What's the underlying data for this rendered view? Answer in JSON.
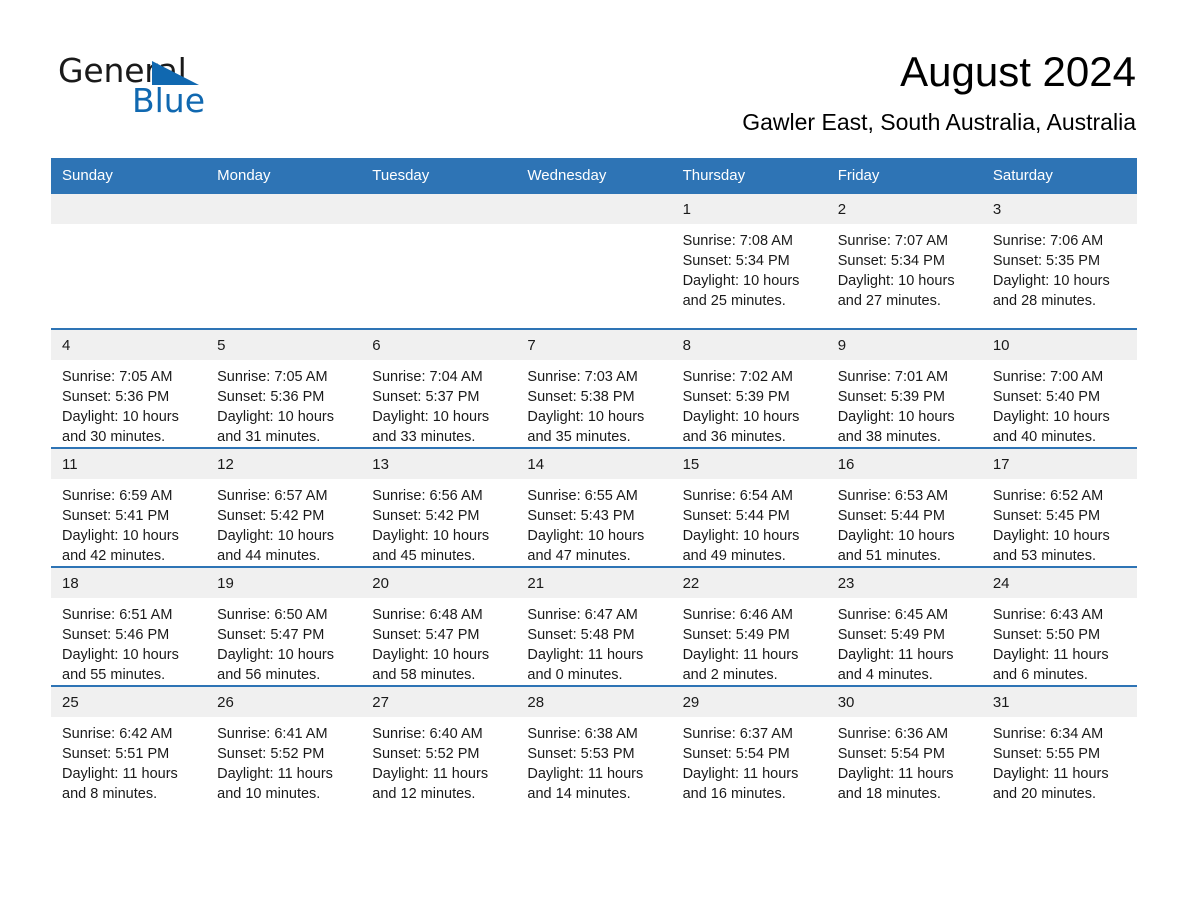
{
  "logo": {
    "word_one": "General",
    "word_two": "Blue",
    "triangle_color": "#1068b0",
    "icon": "triangle-icon"
  },
  "header": {
    "title": "August 2024",
    "location": "Gawler East, South Australia, Australia"
  },
  "theme": {
    "header_blue": "#2e74b5",
    "daynum_band": "#f0f0f0",
    "text": "#1a1a1a"
  },
  "weekdays": [
    "Sunday",
    "Monday",
    "Tuesday",
    "Wednesday",
    "Thursday",
    "Friday",
    "Saturday"
  ],
  "weeks": [
    [
      {
        "day": "",
        "lines": []
      },
      {
        "day": "",
        "lines": []
      },
      {
        "day": "",
        "lines": []
      },
      {
        "day": "",
        "lines": []
      },
      {
        "day": "1",
        "lines": [
          "Sunrise: 7:08 AM",
          "Sunset: 5:34 PM",
          "Daylight: 10 hours",
          "and 25 minutes."
        ]
      },
      {
        "day": "2",
        "lines": [
          "Sunrise: 7:07 AM",
          "Sunset: 5:34 PM",
          "Daylight: 10 hours",
          "and 27 minutes."
        ]
      },
      {
        "day": "3",
        "lines": [
          "Sunrise: 7:06 AM",
          "Sunset: 5:35 PM",
          "Daylight: 10 hours",
          "and 28 minutes."
        ]
      }
    ],
    [
      {
        "day": "4",
        "lines": [
          "Sunrise: 7:05 AM",
          "Sunset: 5:36 PM",
          "Daylight: 10 hours",
          "and 30 minutes."
        ]
      },
      {
        "day": "5",
        "lines": [
          "Sunrise: 7:05 AM",
          "Sunset: 5:36 PM",
          "Daylight: 10 hours",
          "and 31 minutes."
        ]
      },
      {
        "day": "6",
        "lines": [
          "Sunrise: 7:04 AM",
          "Sunset: 5:37 PM",
          "Daylight: 10 hours",
          "and 33 minutes."
        ]
      },
      {
        "day": "7",
        "lines": [
          "Sunrise: 7:03 AM",
          "Sunset: 5:38 PM",
          "Daylight: 10 hours",
          "and 35 minutes."
        ]
      },
      {
        "day": "8",
        "lines": [
          "Sunrise: 7:02 AM",
          "Sunset: 5:39 PM",
          "Daylight: 10 hours",
          "and 36 minutes."
        ]
      },
      {
        "day": "9",
        "lines": [
          "Sunrise: 7:01 AM",
          "Sunset: 5:39 PM",
          "Daylight: 10 hours",
          "and 38 minutes."
        ]
      },
      {
        "day": "10",
        "lines": [
          "Sunrise: 7:00 AM",
          "Sunset: 5:40 PM",
          "Daylight: 10 hours",
          "and 40 minutes."
        ]
      }
    ],
    [
      {
        "day": "11",
        "lines": [
          "Sunrise: 6:59 AM",
          "Sunset: 5:41 PM",
          "Daylight: 10 hours",
          "and 42 minutes."
        ]
      },
      {
        "day": "12",
        "lines": [
          "Sunrise: 6:57 AM",
          "Sunset: 5:42 PM",
          "Daylight: 10 hours",
          "and 44 minutes."
        ]
      },
      {
        "day": "13",
        "lines": [
          "Sunrise: 6:56 AM",
          "Sunset: 5:42 PM",
          "Daylight: 10 hours",
          "and 45 minutes."
        ]
      },
      {
        "day": "14",
        "lines": [
          "Sunrise: 6:55 AM",
          "Sunset: 5:43 PM",
          "Daylight: 10 hours",
          "and 47 minutes."
        ]
      },
      {
        "day": "15",
        "lines": [
          "Sunrise: 6:54 AM",
          "Sunset: 5:44 PM",
          "Daylight: 10 hours",
          "and 49 minutes."
        ]
      },
      {
        "day": "16",
        "lines": [
          "Sunrise: 6:53 AM",
          "Sunset: 5:44 PM",
          "Daylight: 10 hours",
          "and 51 minutes."
        ]
      },
      {
        "day": "17",
        "lines": [
          "Sunrise: 6:52 AM",
          "Sunset: 5:45 PM",
          "Daylight: 10 hours",
          "and 53 minutes."
        ]
      }
    ],
    [
      {
        "day": "18",
        "lines": [
          "Sunrise: 6:51 AM",
          "Sunset: 5:46 PM",
          "Daylight: 10 hours",
          "and 55 minutes."
        ]
      },
      {
        "day": "19",
        "lines": [
          "Sunrise: 6:50 AM",
          "Sunset: 5:47 PM",
          "Daylight: 10 hours",
          "and 56 minutes."
        ]
      },
      {
        "day": "20",
        "lines": [
          "Sunrise: 6:48 AM",
          "Sunset: 5:47 PM",
          "Daylight: 10 hours",
          "and 58 minutes."
        ]
      },
      {
        "day": "21",
        "lines": [
          "Sunrise: 6:47 AM",
          "Sunset: 5:48 PM",
          "Daylight: 11 hours",
          "and 0 minutes."
        ]
      },
      {
        "day": "22",
        "lines": [
          "Sunrise: 6:46 AM",
          "Sunset: 5:49 PM",
          "Daylight: 11 hours",
          "and 2 minutes."
        ]
      },
      {
        "day": "23",
        "lines": [
          "Sunrise: 6:45 AM",
          "Sunset: 5:49 PM",
          "Daylight: 11 hours",
          "and 4 minutes."
        ]
      },
      {
        "day": "24",
        "lines": [
          "Sunrise: 6:43 AM",
          "Sunset: 5:50 PM",
          "Daylight: 11 hours",
          "and 6 minutes."
        ]
      }
    ],
    [
      {
        "day": "25",
        "lines": [
          "Sunrise: 6:42 AM",
          "Sunset: 5:51 PM",
          "Daylight: 11 hours",
          "and 8 minutes."
        ]
      },
      {
        "day": "26",
        "lines": [
          "Sunrise: 6:41 AM",
          "Sunset: 5:52 PM",
          "Daylight: 11 hours",
          "and 10 minutes."
        ]
      },
      {
        "day": "27",
        "lines": [
          "Sunrise: 6:40 AM",
          "Sunset: 5:52 PM",
          "Daylight: 11 hours",
          "and 12 minutes."
        ]
      },
      {
        "day": "28",
        "lines": [
          "Sunrise: 6:38 AM",
          "Sunset: 5:53 PM",
          "Daylight: 11 hours",
          "and 14 minutes."
        ]
      },
      {
        "day": "29",
        "lines": [
          "Sunrise: 6:37 AM",
          "Sunset: 5:54 PM",
          "Daylight: 11 hours",
          "and 16 minutes."
        ]
      },
      {
        "day": "30",
        "lines": [
          "Sunrise: 6:36 AM",
          "Sunset: 5:54 PM",
          "Daylight: 11 hours",
          "and 18 minutes."
        ]
      },
      {
        "day": "31",
        "lines": [
          "Sunrise: 6:34 AM",
          "Sunset: 5:55 PM",
          "Daylight: 11 hours",
          "and 20 minutes."
        ]
      }
    ]
  ]
}
